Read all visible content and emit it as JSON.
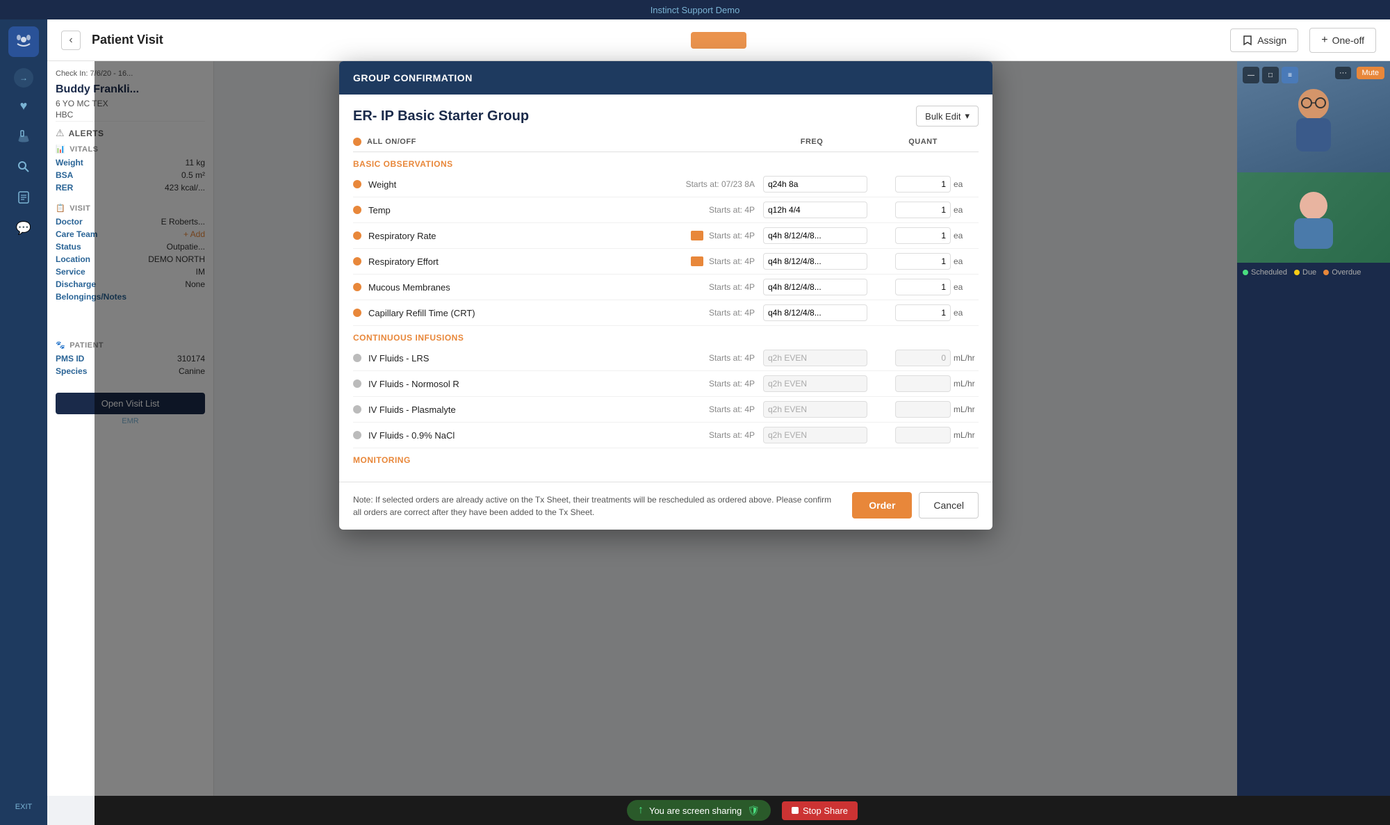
{
  "app": {
    "title": "Instinct Support Demo"
  },
  "topbar": {
    "title": "Instinct Support Demo"
  },
  "header": {
    "back_label": "‹",
    "title": "Patient Visit",
    "assign_label": "Assign",
    "oneoff_label": "One-off"
  },
  "patient": {
    "name": "Buddy Frankli...",
    "check_in": "Check In: 7/6/20 - 16...",
    "age_breed": "6 YO MC TEX",
    "notes": "HBC",
    "alerts_label": "ALERTS"
  },
  "vitals": {
    "section_label": "VITALS",
    "weight_label": "Weight",
    "weight_value": "11 kg",
    "bsa_label": "BSA",
    "bsa_value": "0.5 m²",
    "rer_label": "RER",
    "rer_value": "423 kcal/..."
  },
  "visit": {
    "section_label": "VISIT",
    "doctor_label": "Doctor",
    "doctor_value": "E Roberts...",
    "care_team_label": "Care Team",
    "add_label": "+ Add",
    "status_label": "Status",
    "status_value": "Outpatie...",
    "location_label": "Location",
    "location_value": "DEMO NORTH",
    "service_label": "Service",
    "service_value": "IM",
    "discharge_label": "Discharge",
    "discharge_value": "None",
    "belongings_label": "Belongings/Notes"
  },
  "patient_section": {
    "section_label": "PATIENT",
    "pms_id_label": "PMS ID",
    "pms_id_value": "310174",
    "species_label": "Species",
    "species_value": "Canine"
  },
  "open_visit_btn": "Open Visit List",
  "emr_label": "EMR",
  "sidebar": {
    "items": [
      {
        "icon": "🐾",
        "name": "logo"
      },
      {
        "icon": "←",
        "name": "arrow"
      },
      {
        "icon": "♥",
        "name": "heart"
      },
      {
        "icon": "🔬",
        "name": "lab"
      },
      {
        "icon": "🔍",
        "name": "search"
      },
      {
        "icon": "📋",
        "name": "notes"
      },
      {
        "icon": "💬",
        "name": "chat"
      }
    ],
    "exit_label": "EXIT"
  },
  "modal": {
    "header": "GROUP CONFIRMATION",
    "title": "ER- IP Basic Starter Group",
    "bulk_edit_label": "Bulk Edit",
    "all_on_off_label": "ALL ON/OFF",
    "freq_col": "FREQ",
    "quant_col": "QUANT",
    "sections": [
      {
        "name": "BASIC OBSERVATIONS",
        "items": [
          {
            "name": "Weight",
            "starts": "Starts at: 07/23 8A",
            "freq": "q24h 8a",
            "quant": "1",
            "unit": "ea",
            "active": true,
            "warning": false
          },
          {
            "name": "Temp",
            "starts": "Starts at: 4P",
            "freq": "q12h 4/4",
            "quant": "1",
            "unit": "ea",
            "active": true,
            "warning": false
          },
          {
            "name": "Respiratory Rate",
            "starts": "Starts at: 4P",
            "freq": "q4h 8/12/4/8...",
            "quant": "1",
            "unit": "ea",
            "active": true,
            "warning": true
          },
          {
            "name": "Respiratory Effort",
            "starts": "Starts at: 4P",
            "freq": "q4h 8/12/4/8...",
            "quant": "1",
            "unit": "ea",
            "active": true,
            "warning": true
          },
          {
            "name": "Mucous Membranes",
            "starts": "Starts at: 4P",
            "freq": "q4h 8/12/4/8...",
            "quant": "1",
            "unit": "ea",
            "active": true,
            "warning": false
          },
          {
            "name": "Capillary Refill Time (CRT)",
            "starts": "Starts at: 4P",
            "freq": "q4h 8/12/4/8...",
            "quant": "1",
            "unit": "ea",
            "active": true,
            "warning": false
          }
        ]
      },
      {
        "name": "CONTINUOUS INFUSIONS",
        "items": [
          {
            "name": "IV Fluids - LRS",
            "starts": "Starts at: 4P",
            "freq": "q2h EVEN",
            "quant": "0",
            "unit": "mL/hr",
            "active": false,
            "warning": false
          },
          {
            "name": "IV Fluids - Normosol R",
            "starts": "Starts at: 4P",
            "freq": "q2h EVEN",
            "quant": "",
            "unit": "mL/hr",
            "active": false,
            "warning": false
          },
          {
            "name": "IV Fluids - Plasmalyte",
            "starts": "Starts at: 4P",
            "freq": "q2h EVEN",
            "quant": "",
            "unit": "mL/hr",
            "active": false,
            "warning": false
          },
          {
            "name": "IV Fluids - 0.9% NaCl",
            "starts": "Starts at: 4P",
            "freq": "q2h EVEN",
            "quant": "",
            "unit": "mL/hr",
            "active": false,
            "warning": false
          }
        ]
      },
      {
        "name": "MONITORING",
        "items": []
      }
    ],
    "footer_note": "Note: If selected orders are already active on the Tx Sheet, their treatments will be rescheduled as ordered above. Please confirm all orders are correct after they have been added to the Tx Sheet.",
    "order_btn": "Order",
    "cancel_btn": "Cancel"
  },
  "video": {
    "mute_label": "Mute",
    "legend": {
      "scheduled_label": "Scheduled",
      "due_label": "Due",
      "overdue_label": "Overdue"
    }
  },
  "screen_share": {
    "status_text": "You are screen sharing",
    "stop_label": "Stop Share"
  }
}
